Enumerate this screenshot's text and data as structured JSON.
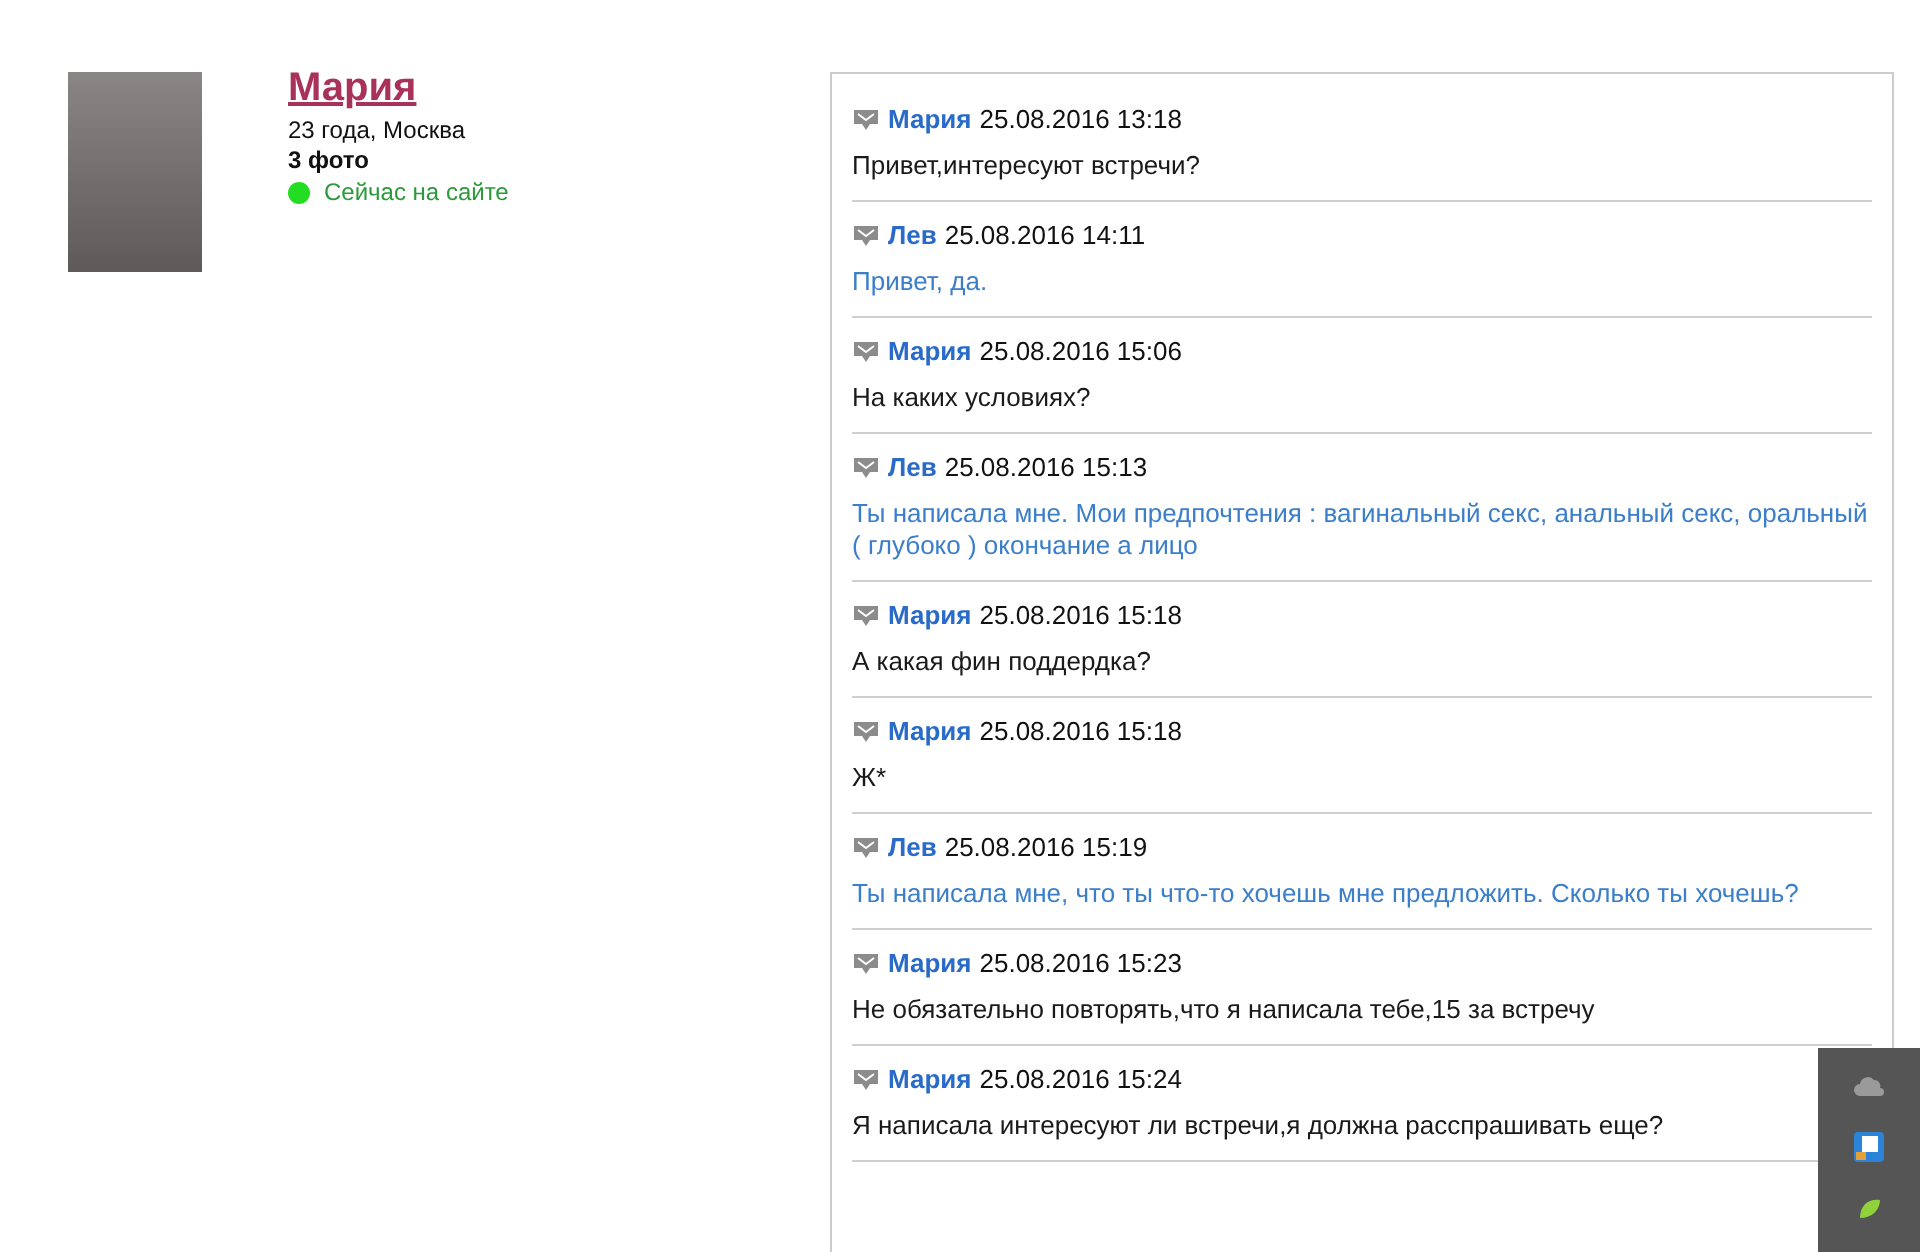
{
  "profile": {
    "name": "Мария",
    "details": "23 года, Москва",
    "photos": "3 фото",
    "online": true,
    "status": "Сейчас на сайте"
  },
  "messages": [
    {
      "kind": "incoming",
      "author": "Мария",
      "time": "25.08.2016 13:18",
      "text": "Привет,интересуют встречи?"
    },
    {
      "kind": "outgoing",
      "author": "Лев",
      "time": "25.08.2016 14:11",
      "text": "Привет, да."
    },
    {
      "kind": "incoming",
      "author": "Мария",
      "time": "25.08.2016 15:06",
      "text": "На каких условиях?"
    },
    {
      "kind": "outgoing",
      "author": "Лев",
      "time": "25.08.2016 15:13",
      "text": "Ты написала мне. Мои предпочтения : вагинальный секс, анальный секс, оральный ( глубоко ) окончание а лицо"
    },
    {
      "kind": "incoming",
      "author": "Мария",
      "time": "25.08.2016 15:18",
      "text": "А какая фин поддердка?"
    },
    {
      "kind": "incoming",
      "author": "Мария",
      "time": "25.08.2016 15:18",
      "text": "Ж*"
    },
    {
      "kind": "outgoing",
      "author": "Лев",
      "time": "25.08.2016 15:19",
      "text": "Ты написала мне, что ты что-то хочешь мне предложить. Сколько ты хочешь?"
    },
    {
      "kind": "incoming",
      "author": "Мария",
      "time": "25.08.2016 15:23",
      "text": "Не обязательно повторять,что я написала тебе,15 за встречу"
    },
    {
      "kind": "incoming",
      "author": "Мария",
      "time": "25.08.2016 15:24",
      "text": "Я написала интересуют ли встречи,я должна расспрашивать еще?"
    }
  ]
}
